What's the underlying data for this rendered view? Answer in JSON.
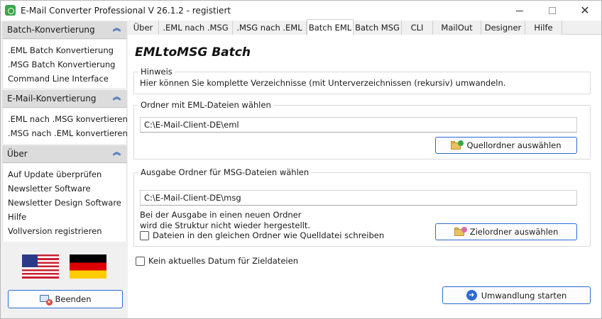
{
  "titlebar": {
    "title": "E-Mail Converter Professional V 26.1.2 - registiert",
    "minimize_label": "",
    "maximize_label": "",
    "close_glyph": "✕"
  },
  "sidebar": {
    "groups": [
      {
        "title": "Batch-Konvertierung",
        "chevron": "︽",
        "items": [
          ".EML Batch Konvertierung",
          ".MSG Batch Konvertierung",
          "Command Line Interface"
        ]
      },
      {
        "title": "E-Mail-Konvertierung",
        "chevron": "︽",
        "items": [
          ".EML nach .MSG konvertieren",
          ".MSG nach .EML konvertieren"
        ]
      },
      {
        "title": "Über",
        "chevron": "︽",
        "items": [
          "Auf Update überprüfen",
          "Newsletter Software",
          "Newsletter Design Software",
          "Hilfe",
          "Vollversion registrieren"
        ]
      }
    ],
    "flags": [
      "us-flag",
      "de-flag"
    ],
    "exit_button": "Beenden"
  },
  "tabs": {
    "items": [
      "Über",
      ".EML nach .MSG",
      ".MSG nach .EML",
      "Batch EML",
      "Batch MSG",
      "CLI",
      "MailOut",
      "Designer",
      "Hilfe"
    ],
    "active": "Batch EML"
  },
  "panel": {
    "title": "EMLtoMSG Batch",
    "hint": {
      "legend": "Hinweis",
      "text": "Hier können Sie komplette Verzeichnisse (mit Unterverzeichnissen (rekursiv) umwandeln."
    },
    "source": {
      "legend": "Ordner mit EML-Dateien wählen",
      "path": "C:\\E-Mail-Client-DE\\eml",
      "button": "Quellordner auswählen"
    },
    "output": {
      "legend": "Ausgabe Ordner für MSG-Dateien wählen",
      "path": "C:\\E-Mail-Client-DE\\msg",
      "note_line1": "Bei der Ausgabe in einen neuen Ordner",
      "note_line2": "wird die Struktur nicht wieder hergestellt.",
      "same_folder_checkbox": "Dateien in den gleichen Ordner wie Quelldatei schreiben",
      "same_folder_checked": false,
      "button": "Zielordner auswählen"
    },
    "no_date_checkbox": "Kein aktuelles Datum für Zieldateien",
    "no_date_checked": false,
    "start_button": "Umwandlung starten"
  },
  "colors": {
    "accent": "#2a6bd2",
    "sidebar_header": "#dcdcdc",
    "app_icon": "#3aa64a"
  }
}
